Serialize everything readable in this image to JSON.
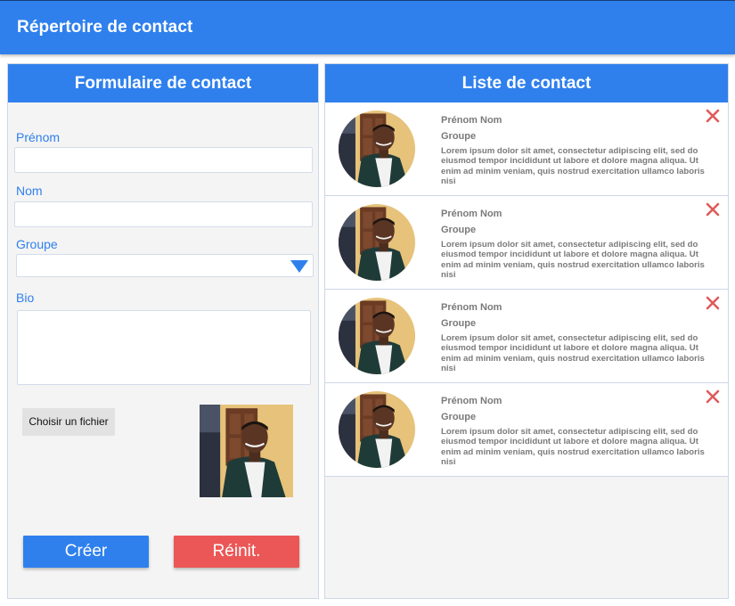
{
  "app": {
    "title": "Répertoire de contact"
  },
  "form": {
    "title": "Formulaire de contact",
    "fields": {
      "first_name": {
        "label": "Prénom",
        "value": ""
      },
      "last_name": {
        "label": "Nom",
        "value": ""
      },
      "group": {
        "label": "Groupe",
        "value": ""
      },
      "bio": {
        "label": "Bio",
        "value": ""
      }
    },
    "file_button": "Choisir un fichier",
    "create_button": "Créer",
    "reset_button": "Réinit."
  },
  "list": {
    "title": "Liste de contact",
    "contacts": [
      {
        "name": "Prénom Nom",
        "group": "Groupe",
        "bio": "Lorem ipsum dolor sit amet, consectetur adipiscing elit, sed do eiusmod tempor incididunt ut labore et dolore magna aliqua. Ut enim ad minim veniam, quis nostrud exercitation ullamco laboris nisi"
      },
      {
        "name": "Prénom Nom",
        "group": "Groupe",
        "bio": "Lorem ipsum dolor sit amet, consectetur adipiscing elit, sed do eiusmod tempor incididunt ut labore et dolore magna aliqua. Ut enim ad minim veniam, quis nostrud exercitation ullamco laboris nisi"
      },
      {
        "name": "Prénom Nom",
        "group": "Groupe",
        "bio": "Lorem ipsum dolor sit amet, consectetur adipiscing elit, sed do eiusmod tempor incididunt ut labore et dolore magna aliqua. Ut enim ad minim veniam, quis nostrud exercitation ullamco laboris nisi"
      },
      {
        "name": "Prénom Nom",
        "group": "Groupe",
        "bio": "Lorem ipsum dolor sit amet, consectetur adipiscing elit, sed do eiusmod tempor incididunt ut labore et dolore magna aliqua. Ut enim ad minim veniam, quis nostrud exercitation ullamco laboris nisi"
      }
    ]
  },
  "icons": {
    "delete": "close-icon",
    "dropdown": "triangle-down-icon",
    "photo": "person-photo"
  },
  "colors": {
    "primary": "#2f80ed",
    "danger": "#eb5757",
    "delete_icon": "#e05a5a"
  }
}
